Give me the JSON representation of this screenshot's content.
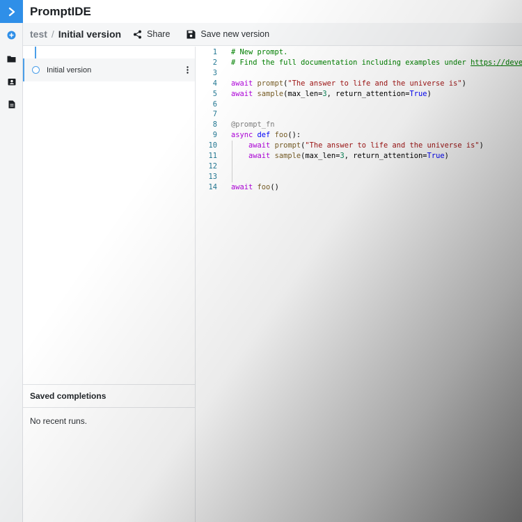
{
  "app": {
    "title": "PromptIDE"
  },
  "breadcrumb": {
    "root": "test",
    "separator": "/",
    "current": "Initial version"
  },
  "toolbar": {
    "share_label": "Share",
    "save_label": "Save new version"
  },
  "rail": {
    "icons": [
      "logo-chevron-icon",
      "add-circle-icon",
      "folder-icon",
      "contacts-icon",
      "document-icon"
    ]
  },
  "versions": [
    {
      "label": "Initial version"
    }
  ],
  "saved": {
    "header": "Saved completions",
    "empty_text": "No recent runs."
  },
  "editor": {
    "line_numbers": [
      "1",
      "2",
      "3",
      "4",
      "5",
      "6",
      "7",
      "8",
      "9",
      "10",
      "11",
      "12",
      "13",
      "14"
    ],
    "lines": [
      [
        {
          "t": "# New prompt.",
          "c": "c-com"
        }
      ],
      [
        {
          "t": "# Find the full documentation including examples under ",
          "c": "c-com"
        },
        {
          "t": "https://developers.x.ai/ide/",
          "c": "c-link"
        }
      ],
      [],
      [
        {
          "t": "await ",
          "c": "c-kw"
        },
        {
          "t": "prompt",
          "c": "c-fn"
        },
        {
          "t": "(",
          "c": ""
        },
        {
          "t": "\"The answer to life and the universe is\"",
          "c": "c-str"
        },
        {
          "t": ")",
          "c": ""
        }
      ],
      [
        {
          "t": "await ",
          "c": "c-kw"
        },
        {
          "t": "sample",
          "c": "c-fn"
        },
        {
          "t": "(max_len=",
          "c": ""
        },
        {
          "t": "3",
          "c": "c-num"
        },
        {
          "t": ", return_attention=",
          "c": ""
        },
        {
          "t": "True",
          "c": "c-const"
        },
        {
          "t": ")",
          "c": ""
        }
      ],
      [],
      [],
      [
        {
          "t": "@prompt_fn",
          "c": "c-dec"
        }
      ],
      [
        {
          "t": "async ",
          "c": "c-kw"
        },
        {
          "t": "def ",
          "c": "c-const"
        },
        {
          "t": "foo",
          "c": "c-fn"
        },
        {
          "t": "():",
          "c": ""
        }
      ],
      [
        {
          "t": "    ",
          "c": ""
        },
        {
          "t": "await ",
          "c": "c-kw"
        },
        {
          "t": "prompt",
          "c": "c-fn"
        },
        {
          "t": "(",
          "c": ""
        },
        {
          "t": "\"The answer to life and the universe is\"",
          "c": "c-str"
        },
        {
          "t": ")",
          "c": ""
        }
      ],
      [
        {
          "t": "    ",
          "c": ""
        },
        {
          "t": "await ",
          "c": "c-kw"
        },
        {
          "t": "sample",
          "c": "c-fn"
        },
        {
          "t": "(max_len=",
          "c": ""
        },
        {
          "t": "3",
          "c": "c-num"
        },
        {
          "t": ", return_attention=",
          "c": ""
        },
        {
          "t": "True",
          "c": "c-const"
        },
        {
          "t": ")",
          "c": ""
        }
      ],
      [],
      [],
      [
        {
          "t": "await ",
          "c": "c-kw"
        },
        {
          "t": "foo",
          "c": "c-fn"
        },
        {
          "t": "()",
          "c": ""
        }
      ]
    ]
  },
  "colors": {
    "accent": "#2f8fe8",
    "timeline": "#4a9ee8"
  }
}
